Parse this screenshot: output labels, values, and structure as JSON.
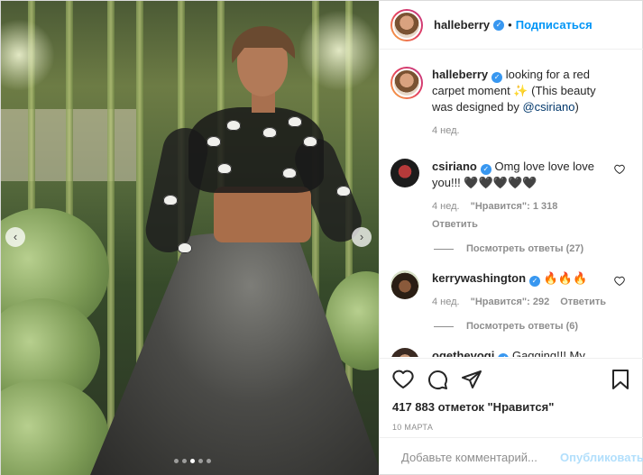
{
  "post": {
    "username": "halleberry",
    "follow_label": "Подписаться",
    "separator": "•"
  },
  "caption": {
    "username": "halleberry",
    "text_before": " looking for a red carpet moment ✨ (This beauty was designed by ",
    "mention": "@csiriano",
    "text_after": ")",
    "time": "4 нед."
  },
  "comments": [
    {
      "username": "csiriano",
      "text": " Omg love love love you!!! 🖤🖤🖤🖤🖤",
      "time": "4 нед.",
      "likes": "\"Нравится\": 1 318",
      "reply": "Ответить",
      "view_replies": "Посмотреть ответы (27)"
    },
    {
      "username": "kerrywashington",
      "text": " 🔥🔥🔥",
      "time": "4 нед.",
      "likes": "\"Нравится\": 292",
      "reply": "Ответить",
      "view_replies": "Посмотреть ответы (6)"
    },
    {
      "username": "ogethevogi",
      "text": " Gagging!!! My"
    }
  ],
  "actions": {
    "likes_count": "417 883 отметок \"Нравится\"",
    "date": "10 МАРТА"
  },
  "add_comment": {
    "placeholder": "Добавьте комментарий...",
    "publish_label": "Опубликовать"
  },
  "carousel": {
    "prev_icon": "‹",
    "next_icon": "›",
    "slides": 5,
    "active": 2
  },
  "colors": {
    "link": "#0095f6",
    "publish_disabled": "#b2dffc",
    "muted": "#8e8e8e",
    "verified": "#3897f0"
  }
}
